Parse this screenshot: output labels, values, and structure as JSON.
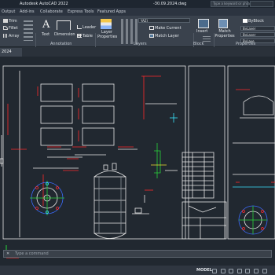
{
  "title_bar": {
    "app_title": "Autodesk AutoCAD 2022",
    "file_name": "-30.09.2024.dwg",
    "search_placeholder": "Type a keyword or phrase"
  },
  "menu_tabs": [
    "Output",
    "Add-ins",
    "Collaborate",
    "Express Tools",
    "Featured Apps"
  ],
  "ribbon": {
    "modify": {
      "trim": "Trim",
      "fillet": "Fillet",
      "array": "Array"
    },
    "annotation": {
      "text": "Text",
      "dimension": "Dimension",
      "leader": "Leader",
      "table": "Table",
      "panel_label": "Annotation"
    },
    "layers": {
      "layer_properties": "Layer Properties",
      "current_layer": "YAZI",
      "make_current": "Make Current",
      "match_layer": "Match Layer",
      "panel_label": "Layers"
    },
    "block": {
      "insert": "Insert",
      "panel_label": "Block"
    },
    "properties": {
      "match_properties": "Match Properties",
      "bylayer_1": "ByBlock",
      "bylayer_2": "ByLayer",
      "bylayer_3": "ByLayer",
      "bylayer_4": "ByLaye",
      "panel_label": "Properties"
    }
  },
  "file_tab": "2024",
  "command_line": {
    "placeholder": "Type a command",
    "close": "✕"
  },
  "status_bar": {
    "model": "MODEL"
  },
  "colors": {
    "line_white": "#e8e8e8",
    "line_red": "#ff2a2a",
    "line_cyan": "#38e5ff",
    "line_green": "#28d43a",
    "line_blue": "#3b6cff",
    "line_yellow": "#f4e430"
  }
}
